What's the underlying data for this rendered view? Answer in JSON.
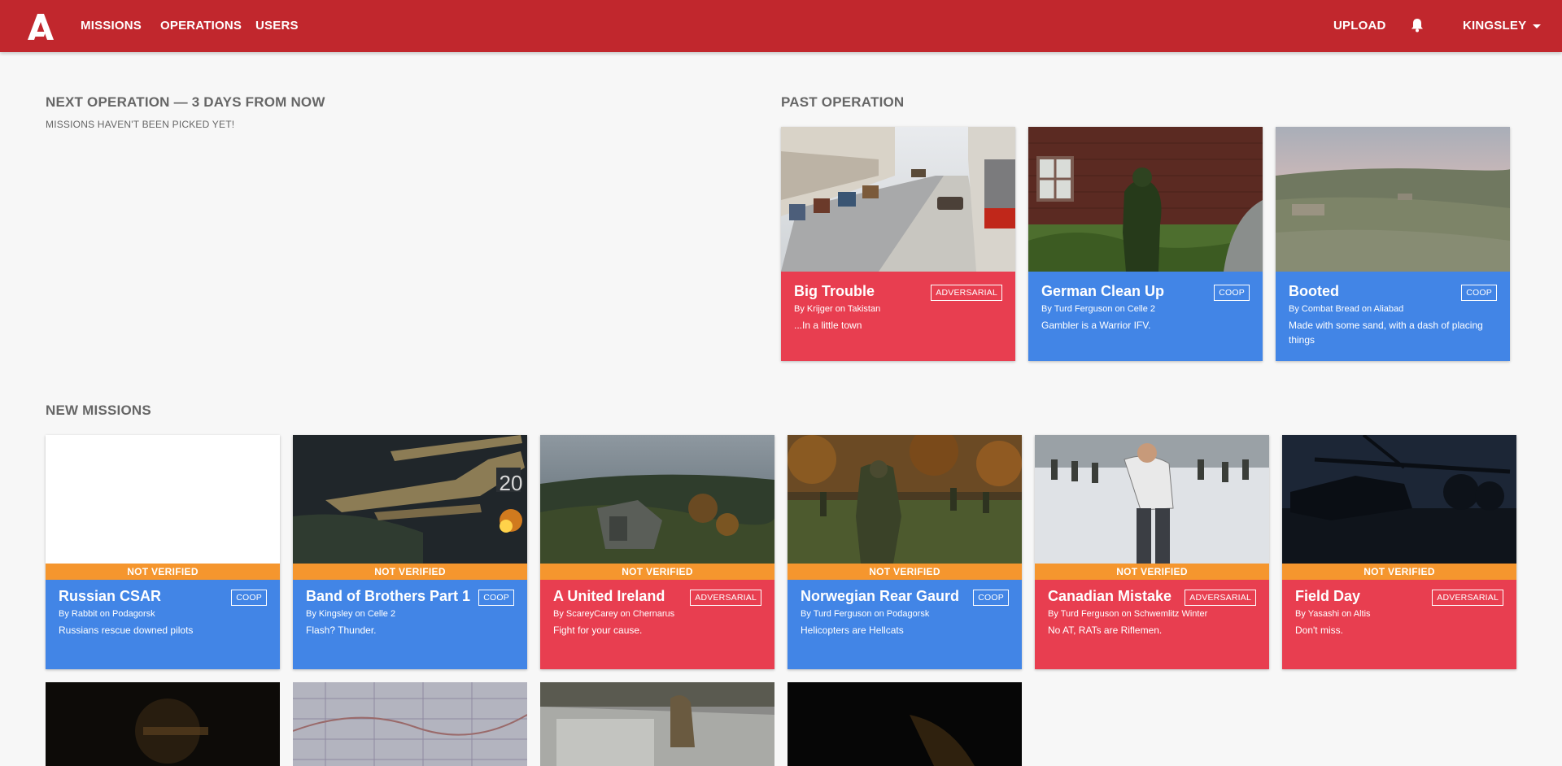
{
  "nav": {
    "logo_letter": "A",
    "missions": "MISSIONS",
    "operations": "OPERATIONS",
    "users": "USERS",
    "upload": "UPLOAD",
    "user": "KINGSLEY"
  },
  "next_operation": {
    "title": "NEXT OPERATION — 3 DAYS FROM NOW",
    "subtitle": "MISSIONS HAVEN'T BEEN PICKED YET!"
  },
  "past_operation": {
    "title": "PAST OPERATION",
    "cards": [
      {
        "title": "Big Trouble",
        "meta": "By Krijger on Takistan",
        "desc": "...In a little town",
        "tag": "ADVERSARIAL"
      },
      {
        "title": "German Clean Up",
        "meta": "By Turd Ferguson on Celle 2",
        "desc": "Gambler is a Warrior IFV.",
        "tag": "COOP"
      },
      {
        "title": "Booted",
        "meta": "By Combat Bread on Aliabad",
        "desc": "Made with some sand, with a dash of placing things",
        "tag": "COOP"
      }
    ]
  },
  "new_missions": {
    "title": "NEW MISSIONS",
    "status_label": "NOT VERIFIED",
    "cards": [
      {
        "title": "Russian CSAR",
        "meta": "By Rabbit on Podagorsk",
        "desc": "Russians rescue downed pilots",
        "tag": "COOP"
      },
      {
        "title": "Band of Brothers Part 1",
        "meta": "By Kingsley on Celle 2",
        "desc": "Flash? Thunder.",
        "tag": "COOP"
      },
      {
        "title": "A United Ireland",
        "meta": "By ScareyCarey on Chernarus",
        "desc": "Fight for your cause.",
        "tag": "ADVERSARIAL"
      },
      {
        "title": "Norwegian Rear Gaurd",
        "meta": "By Turd Ferguson on Podagorsk",
        "desc": "Helicopters are Hellcats",
        "tag": "COOP"
      },
      {
        "title": "Canadian Mistake",
        "meta": "By Turd Ferguson on Schwemlitz Winter",
        "desc": "No AT, RATs are Riflemen.",
        "tag": "ADVERSARIAL"
      },
      {
        "title": "Field Day",
        "meta": "By Yasashi on Altis",
        "desc": "Don't miss.",
        "tag": "ADVERSARIAL"
      }
    ]
  },
  "icons": {
    "logo": "arma-a-logo",
    "bell": "bell-icon",
    "caret": "chevron-down-icon"
  },
  "colors": {
    "navbar": "#c1272d",
    "coop": "#4285e6",
    "adversarial": "#e83e50",
    "not_verified": "#f5962e"
  }
}
